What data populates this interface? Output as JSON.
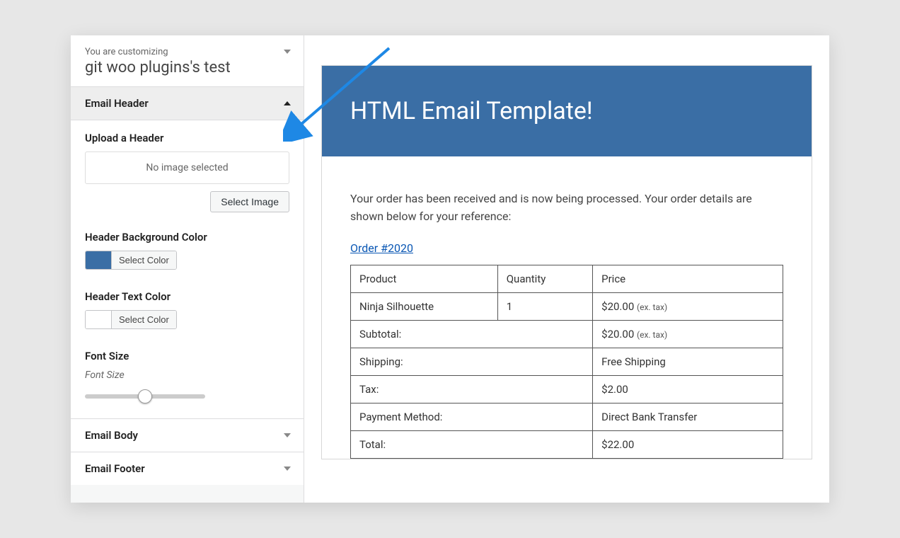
{
  "sidebar": {
    "customizing_label": "You are customizing",
    "site_name": "git woo plugins's test",
    "sections": {
      "header": {
        "title": "Email Header"
      },
      "body": {
        "title": "Email Body"
      },
      "footer": {
        "title": "Email Footer"
      }
    },
    "upload": {
      "label": "Upload a Header",
      "placeholder": "No image selected",
      "select_btn": "Select Image"
    },
    "bg_color": {
      "label": "Header Background Color",
      "btn": "Select Color",
      "swatch": "#3a6ea5"
    },
    "text_color": {
      "label": "Header Text Color",
      "btn": "Select Color",
      "swatch": "#ffffff"
    },
    "font_size": {
      "label": "Font Size",
      "hint": "Font Size",
      "value": 50
    }
  },
  "email": {
    "title": "HTML Email Template!",
    "intro": "Your order has been received and is now being processed. Your order details are shown below for your reference:",
    "order_link": "Order #2020",
    "cols": {
      "product": "Product",
      "qty": "Quantity",
      "price": "Price"
    },
    "items": [
      {
        "name": "Ninja Silhouette",
        "qty": "1",
        "price": "$20.00",
        "note": "(ex. tax)"
      }
    ],
    "totals": {
      "subtotal": {
        "label": "Subtotal:",
        "value": "$20.00",
        "note": "(ex. tax)"
      },
      "shipping": {
        "label": "Shipping:",
        "value": "Free Shipping"
      },
      "tax": {
        "label": "Tax:",
        "value": "$2.00"
      },
      "pay": {
        "label": "Payment Method:",
        "value": "Direct Bank Transfer"
      },
      "total": {
        "label": "Total:",
        "value": "$22.00"
      }
    }
  }
}
